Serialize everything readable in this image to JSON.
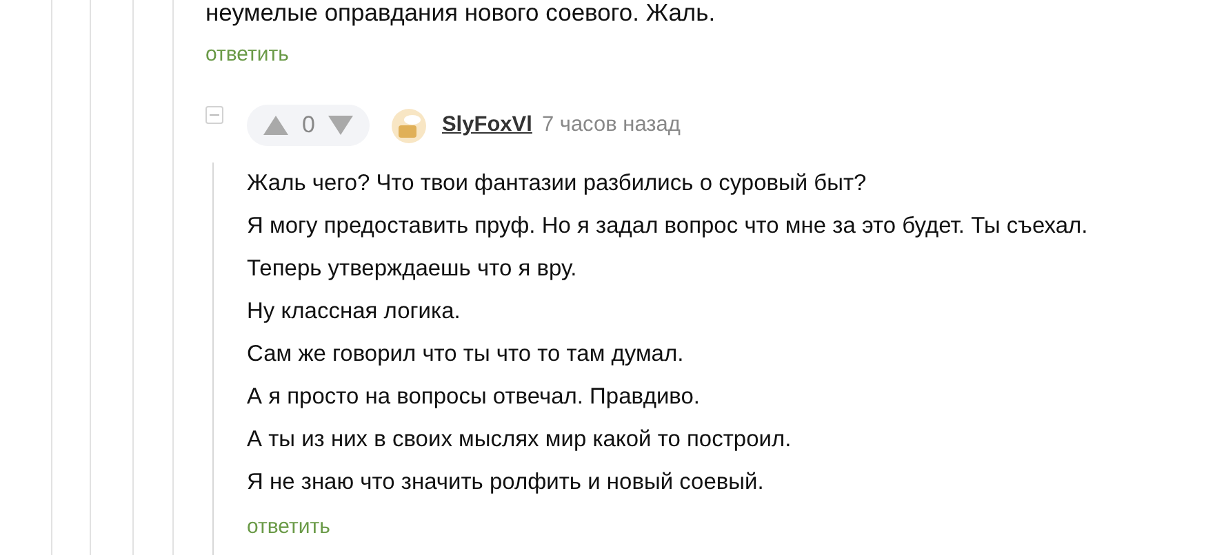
{
  "parent_comment": {
    "text": "неумелые оправдания нового соевого. Жаль.",
    "reply": "ответить"
  },
  "reply_comment": {
    "collapse_expanded": true,
    "score": "0",
    "author": "SlyFoxVl",
    "time": "7 часов назад",
    "lines": [
      "Жаль чего? Что твои фантазии разбились о суровый быт?",
      "Я могу предоставить пруф. Но я задал вопрос что мне за это будет. Ты съехал.",
      "Теперь утверждаешь что я вру.",
      "Ну классная логика.",
      "Сам же говорил что ты что то там думал.",
      "А я просто на вопросы отвечал. Правдиво.",
      "А ты из них в своих мыслях мир какой то построил.",
      "Я не знаю что значить ролфить и новый соевый."
    ],
    "reply": "ответить"
  }
}
